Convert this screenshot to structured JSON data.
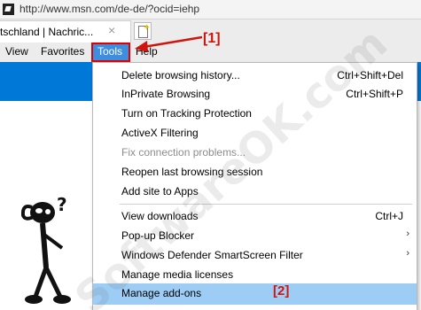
{
  "browser": {
    "url": "http://www.msn.com/de-de/?ocid=iehp",
    "tab_title": "tschland | Nachric...",
    "tab_close_glyph": "×",
    "site_icon": "msn-favicon-icon",
    "new_tab_icon": "new-tab-icon"
  },
  "menubar": {
    "view": "View",
    "favorites": "Favorites",
    "tools": "Tools",
    "help": "Help"
  },
  "annotations": {
    "marker1": "[1]",
    "marker2": "[2]",
    "color": "#d0140e"
  },
  "tools_menu": {
    "items": [
      {
        "label": "Delete browsing history...",
        "shortcut": "Ctrl+Shift+Del"
      },
      {
        "label": "InPrivate Browsing",
        "shortcut": "Ctrl+Shift+P"
      },
      {
        "label": "Turn on Tracking Protection",
        "shortcut": ""
      },
      {
        "label": "ActiveX Filtering",
        "shortcut": ""
      },
      {
        "label": "Fix connection problems...",
        "shortcut": "",
        "disabled": true
      },
      {
        "label": "Reopen last browsing session",
        "shortcut": ""
      },
      {
        "label": "Add site to Apps",
        "shortcut": ""
      },
      {
        "label": "View downloads",
        "shortcut": "Ctrl+J"
      },
      {
        "label": "Pop-up Blocker",
        "shortcut": "",
        "submenu": true
      },
      {
        "label": "Windows Defender SmartScreen Filter",
        "shortcut": "",
        "submenu": true
      },
      {
        "label": "Manage media licenses",
        "shortcut": ""
      },
      {
        "label": "Manage add-ons",
        "shortcut": "",
        "highlighted": true
      }
    ],
    "submenu_glyph": "›"
  },
  "watermark": "SoftwareOK.com",
  "colors": {
    "accent_blue": "#0078d7",
    "menu_highlight": "#9dcdf5",
    "tools_active": "#3e8ee0",
    "annotation_red": "#d0140e"
  }
}
